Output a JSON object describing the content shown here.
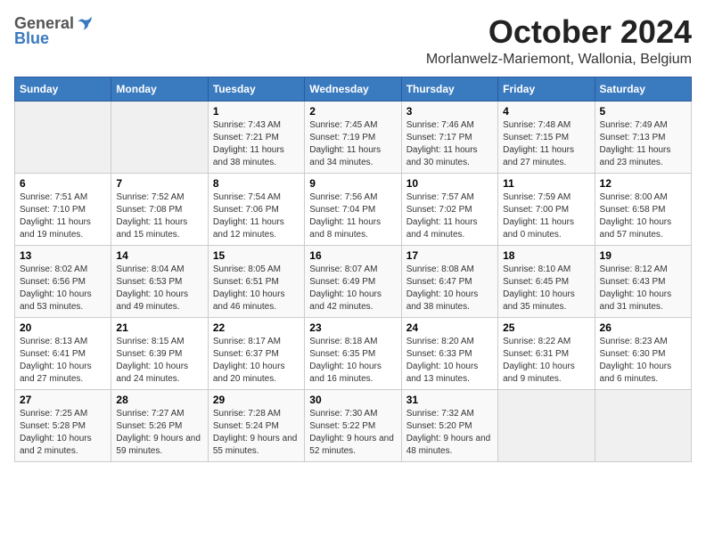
{
  "header": {
    "logo_general": "General",
    "logo_blue": "Blue",
    "month_title": "October 2024",
    "location": "Morlanwelz-Mariemont, Wallonia, Belgium"
  },
  "weekdays": [
    "Sunday",
    "Monday",
    "Tuesday",
    "Wednesday",
    "Thursday",
    "Friday",
    "Saturday"
  ],
  "weeks": [
    [
      {
        "day": "",
        "sunrise": "",
        "sunset": "",
        "daylight": ""
      },
      {
        "day": "",
        "sunrise": "",
        "sunset": "",
        "daylight": ""
      },
      {
        "day": "1",
        "sunrise": "Sunrise: 7:43 AM",
        "sunset": "Sunset: 7:21 PM",
        "daylight": "Daylight: 11 hours and 38 minutes."
      },
      {
        "day": "2",
        "sunrise": "Sunrise: 7:45 AM",
        "sunset": "Sunset: 7:19 PM",
        "daylight": "Daylight: 11 hours and 34 minutes."
      },
      {
        "day": "3",
        "sunrise": "Sunrise: 7:46 AM",
        "sunset": "Sunset: 7:17 PM",
        "daylight": "Daylight: 11 hours and 30 minutes."
      },
      {
        "day": "4",
        "sunrise": "Sunrise: 7:48 AM",
        "sunset": "Sunset: 7:15 PM",
        "daylight": "Daylight: 11 hours and 27 minutes."
      },
      {
        "day": "5",
        "sunrise": "Sunrise: 7:49 AM",
        "sunset": "Sunset: 7:13 PM",
        "daylight": "Daylight: 11 hours and 23 minutes."
      }
    ],
    [
      {
        "day": "6",
        "sunrise": "Sunrise: 7:51 AM",
        "sunset": "Sunset: 7:10 PM",
        "daylight": "Daylight: 11 hours and 19 minutes."
      },
      {
        "day": "7",
        "sunrise": "Sunrise: 7:52 AM",
        "sunset": "Sunset: 7:08 PM",
        "daylight": "Daylight: 11 hours and 15 minutes."
      },
      {
        "day": "8",
        "sunrise": "Sunrise: 7:54 AM",
        "sunset": "Sunset: 7:06 PM",
        "daylight": "Daylight: 11 hours and 12 minutes."
      },
      {
        "day": "9",
        "sunrise": "Sunrise: 7:56 AM",
        "sunset": "Sunset: 7:04 PM",
        "daylight": "Daylight: 11 hours and 8 minutes."
      },
      {
        "day": "10",
        "sunrise": "Sunrise: 7:57 AM",
        "sunset": "Sunset: 7:02 PM",
        "daylight": "Daylight: 11 hours and 4 minutes."
      },
      {
        "day": "11",
        "sunrise": "Sunrise: 7:59 AM",
        "sunset": "Sunset: 7:00 PM",
        "daylight": "Daylight: 11 hours and 0 minutes."
      },
      {
        "day": "12",
        "sunrise": "Sunrise: 8:00 AM",
        "sunset": "Sunset: 6:58 PM",
        "daylight": "Daylight: 10 hours and 57 minutes."
      }
    ],
    [
      {
        "day": "13",
        "sunrise": "Sunrise: 8:02 AM",
        "sunset": "Sunset: 6:56 PM",
        "daylight": "Daylight: 10 hours and 53 minutes."
      },
      {
        "day": "14",
        "sunrise": "Sunrise: 8:04 AM",
        "sunset": "Sunset: 6:53 PM",
        "daylight": "Daylight: 10 hours and 49 minutes."
      },
      {
        "day": "15",
        "sunrise": "Sunrise: 8:05 AM",
        "sunset": "Sunset: 6:51 PM",
        "daylight": "Daylight: 10 hours and 46 minutes."
      },
      {
        "day": "16",
        "sunrise": "Sunrise: 8:07 AM",
        "sunset": "Sunset: 6:49 PM",
        "daylight": "Daylight: 10 hours and 42 minutes."
      },
      {
        "day": "17",
        "sunrise": "Sunrise: 8:08 AM",
        "sunset": "Sunset: 6:47 PM",
        "daylight": "Daylight: 10 hours and 38 minutes."
      },
      {
        "day": "18",
        "sunrise": "Sunrise: 8:10 AM",
        "sunset": "Sunset: 6:45 PM",
        "daylight": "Daylight: 10 hours and 35 minutes."
      },
      {
        "day": "19",
        "sunrise": "Sunrise: 8:12 AM",
        "sunset": "Sunset: 6:43 PM",
        "daylight": "Daylight: 10 hours and 31 minutes."
      }
    ],
    [
      {
        "day": "20",
        "sunrise": "Sunrise: 8:13 AM",
        "sunset": "Sunset: 6:41 PM",
        "daylight": "Daylight: 10 hours and 27 minutes."
      },
      {
        "day": "21",
        "sunrise": "Sunrise: 8:15 AM",
        "sunset": "Sunset: 6:39 PM",
        "daylight": "Daylight: 10 hours and 24 minutes."
      },
      {
        "day": "22",
        "sunrise": "Sunrise: 8:17 AM",
        "sunset": "Sunset: 6:37 PM",
        "daylight": "Daylight: 10 hours and 20 minutes."
      },
      {
        "day": "23",
        "sunrise": "Sunrise: 8:18 AM",
        "sunset": "Sunset: 6:35 PM",
        "daylight": "Daylight: 10 hours and 16 minutes."
      },
      {
        "day": "24",
        "sunrise": "Sunrise: 8:20 AM",
        "sunset": "Sunset: 6:33 PM",
        "daylight": "Daylight: 10 hours and 13 minutes."
      },
      {
        "day": "25",
        "sunrise": "Sunrise: 8:22 AM",
        "sunset": "Sunset: 6:31 PM",
        "daylight": "Daylight: 10 hours and 9 minutes."
      },
      {
        "day": "26",
        "sunrise": "Sunrise: 8:23 AM",
        "sunset": "Sunset: 6:30 PM",
        "daylight": "Daylight: 10 hours and 6 minutes."
      }
    ],
    [
      {
        "day": "27",
        "sunrise": "Sunrise: 7:25 AM",
        "sunset": "Sunset: 5:28 PM",
        "daylight": "Daylight: 10 hours and 2 minutes."
      },
      {
        "day": "28",
        "sunrise": "Sunrise: 7:27 AM",
        "sunset": "Sunset: 5:26 PM",
        "daylight": "Daylight: 9 hours and 59 minutes."
      },
      {
        "day": "29",
        "sunrise": "Sunrise: 7:28 AM",
        "sunset": "Sunset: 5:24 PM",
        "daylight": "Daylight: 9 hours and 55 minutes."
      },
      {
        "day": "30",
        "sunrise": "Sunrise: 7:30 AM",
        "sunset": "Sunset: 5:22 PM",
        "daylight": "Daylight: 9 hours and 52 minutes."
      },
      {
        "day": "31",
        "sunrise": "Sunrise: 7:32 AM",
        "sunset": "Sunset: 5:20 PM",
        "daylight": "Daylight: 9 hours and 48 minutes."
      },
      {
        "day": "",
        "sunrise": "",
        "sunset": "",
        "daylight": ""
      },
      {
        "day": "",
        "sunrise": "",
        "sunset": "",
        "daylight": ""
      }
    ]
  ]
}
